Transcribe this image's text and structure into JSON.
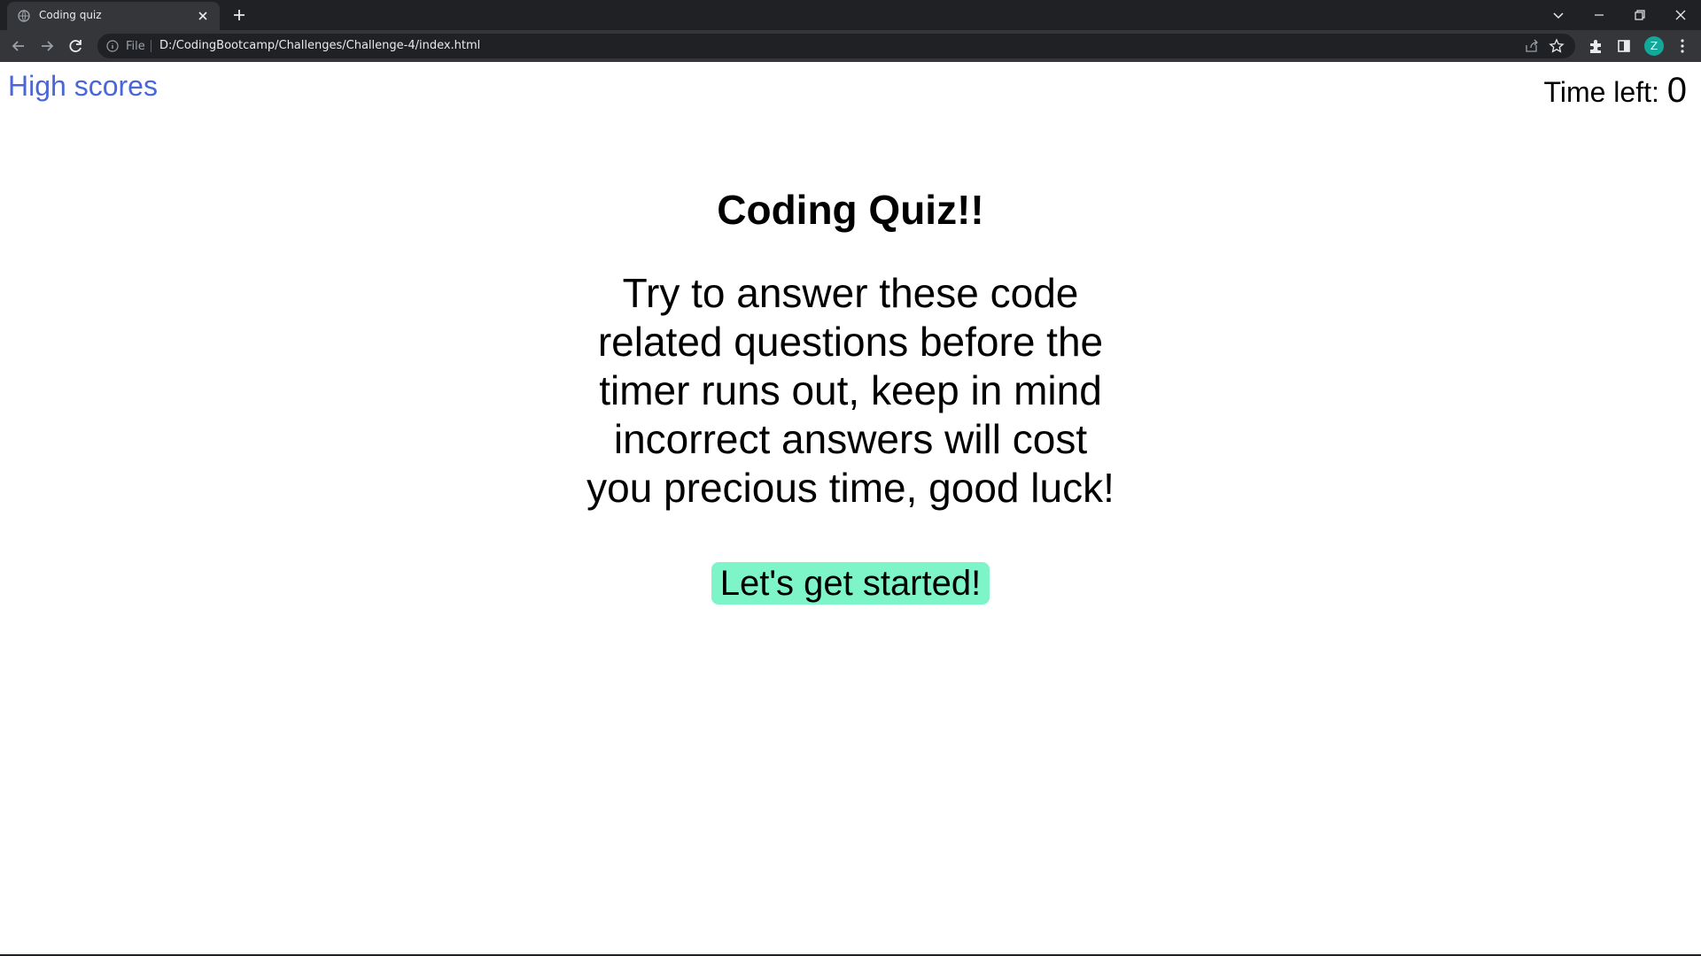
{
  "browser": {
    "tab_title": "Coding quiz",
    "address_scheme": "File",
    "address_url": "D:/CodingBootcamp/Challenges/Challenge-4/index.html",
    "profile_initial": "Z"
  },
  "header": {
    "high_scores_link": "High scores",
    "timer_label": "Time left:",
    "timer_value": "0"
  },
  "main": {
    "title": "Coding Quiz!!",
    "intro": "Try to answer these code related questions before the timer runs out, keep in mind incorrect answers will cost you precious time, good luck!",
    "start_button": "Let's get started!"
  },
  "colors": {
    "link": "#4a67d6",
    "start_button_bg": "#7ef5c9",
    "profile_avatar": "#12a89a"
  },
  "icons": [
    "globe-icon",
    "close-icon",
    "plus-icon",
    "chevron-down-icon",
    "minimize-icon",
    "restore-icon",
    "back-icon",
    "forward-icon",
    "reload-icon",
    "info-icon",
    "share-icon",
    "star-icon",
    "extensions-icon",
    "side-panel-icon",
    "menu-icon"
  ]
}
